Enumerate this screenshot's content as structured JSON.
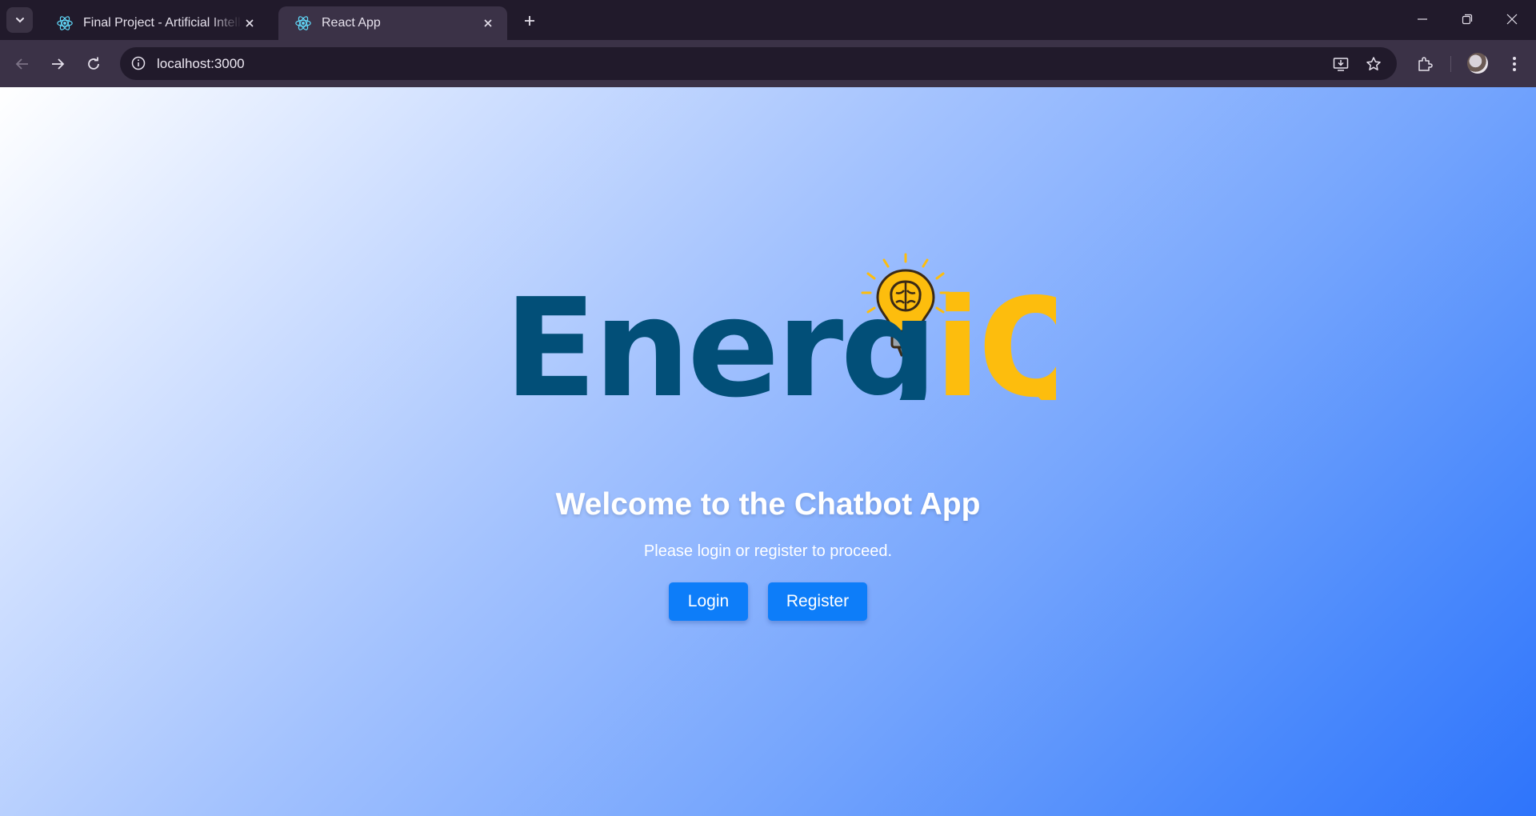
{
  "browser": {
    "tabs": [
      {
        "title": "Final Project - Artificial Intelligence",
        "active": false
      },
      {
        "title": "React App",
        "active": true
      }
    ],
    "address_bar": {
      "url": "localhost:3000"
    }
  },
  "page": {
    "logo": {
      "text_dark": "Energ",
      "text_accent": "iQ",
      "colors": {
        "dark": "#024f78",
        "accent": "#fdbd0d"
      }
    },
    "title": "Welcome to the Chatbot App",
    "subtitle": "Please login or register to proceed.",
    "buttons": {
      "login": "Login",
      "register": "Register"
    },
    "colors": {
      "button": "#0d7df9",
      "gradient_start": "#ffffff",
      "gradient_end": "#2e74fb"
    }
  },
  "icons": [
    "tab-search-icon",
    "react-favicon-icon",
    "close-icon",
    "new-tab-icon",
    "minimize-icon",
    "restore-icon",
    "window-close-icon",
    "back-icon",
    "forward-icon",
    "reload-icon",
    "info-icon",
    "install-app-icon",
    "bookmark-star-icon",
    "extensions-icon",
    "menu-icon",
    "lightbulb-brain-icon"
  ]
}
